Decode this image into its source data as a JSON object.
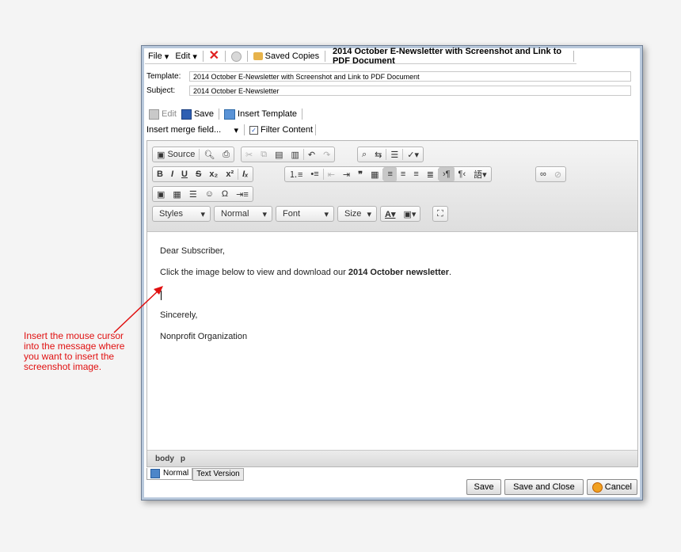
{
  "menubar": {
    "file": "File",
    "edit": "Edit",
    "saved_copies": "Saved Copies",
    "document_title": "2014 October E-Newsletter with Screenshot and Link to PDF Document"
  },
  "fields": {
    "template_label": "Template:",
    "template_value": "2014 October E-Newsletter with Screenshot and Link to PDF Document",
    "subject_label": "Subject:",
    "subject_value": "2014 October E-Newsletter"
  },
  "actions": {
    "edit": "Edit",
    "save": "Save",
    "insert_template": "Insert Template",
    "merge_field": "Insert merge field...",
    "filter_content": "Filter Content"
  },
  "editor_toolbar": {
    "source": "Source",
    "styles": "Styles",
    "format": "Normal",
    "font": "Font",
    "size": "Size"
  },
  "content": {
    "greeting": "Dear Subscriber,",
    "line1_pre": "Click the image below to view and download our ",
    "line1_bold": "2014 October newsletter",
    "line1_post": ".",
    "closing": "Sincerely,",
    "signature": "Nonprofit Organization"
  },
  "pathbar": {
    "body": "body",
    "p": "p"
  },
  "tabs": {
    "normal": "Normal",
    "text_version": "Text Version"
  },
  "buttons": {
    "save": "Save",
    "save_close": "Save and Close",
    "cancel": "Cancel"
  },
  "annotation": "Insert the mouse cursor into the message where you want to insert the screenshot image.",
  "colors": {
    "annotation": "#e01010",
    "window_border": "#b9c9dc"
  }
}
